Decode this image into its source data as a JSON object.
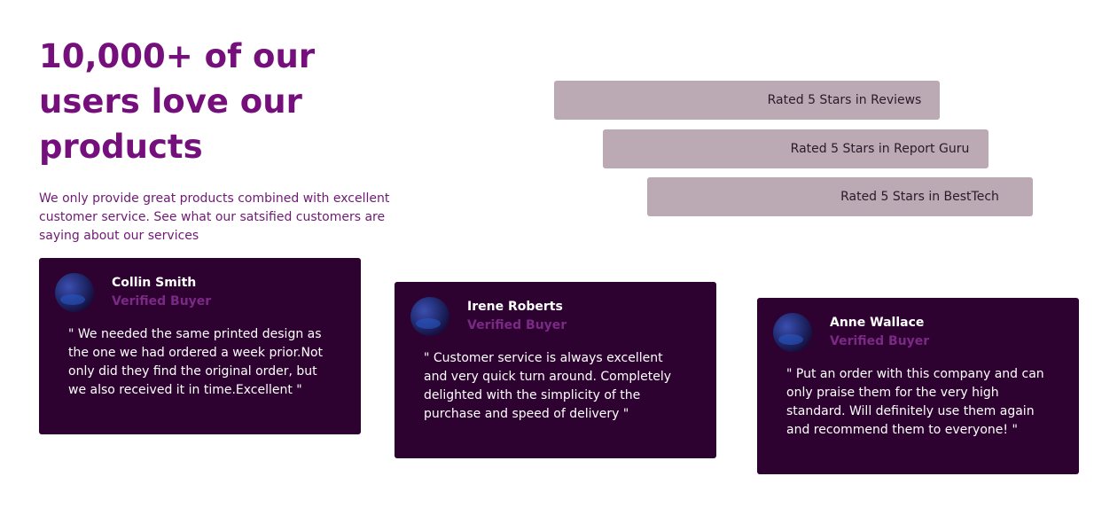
{
  "heading": "10,000+ of our users love our products",
  "subtext": "We only provide great products combined with excellent customer service. See what our satsified customers are saying about our services",
  "ratings": [
    {
      "label": "Rated 5 Stars in Reviews"
    },
    {
      "label": "Rated 5 Stars in Report Guru"
    },
    {
      "label": "Rated 5 Stars in BestTech"
    }
  ],
  "testimonials": [
    {
      "name": "Collin Smith",
      "role": "Verified Buyer",
      "quote": "\" We needed the same printed design as the one we had ordered a week prior.Not only did they find the original order, but we also received it in time.Excellent  \""
    },
    {
      "name": "Irene Roberts",
      "role": "Verified Buyer",
      "quote": "\" Customer service is always excellent and very quick turn around. Completely delighted with the simplicity of the purchase and speed of delivery \""
    },
    {
      "name": "Anne Wallace",
      "role": "Verified Buyer",
      "quote": "\" Put an order with this company and can only praise them for the very high standard. Will definitely use them again and recommend them to everyone! \""
    }
  ],
  "colors": {
    "heading": "#740f7c",
    "card_background": "#2e0230",
    "rating_bar": "#bba9b3",
    "verified": "#7a2a85"
  }
}
